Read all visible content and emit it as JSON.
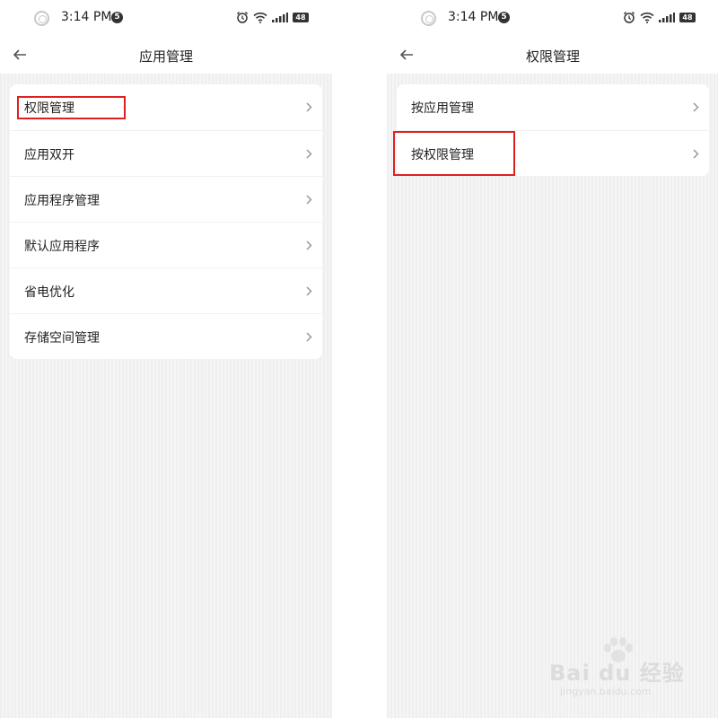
{
  "status": {
    "time": "3:14 PM",
    "badge": "5",
    "battery": "48"
  },
  "left": {
    "title": "应用管理",
    "items": [
      {
        "label": "权限管理"
      },
      {
        "label": "应用双开"
      },
      {
        "label": "应用程序管理"
      },
      {
        "label": "默认应用程序"
      },
      {
        "label": "省电优化"
      },
      {
        "label": "存储空间管理"
      }
    ]
  },
  "right": {
    "title": "权限管理",
    "items": [
      {
        "label": "按应用管理"
      },
      {
        "label": "按权限管理"
      }
    ]
  },
  "watermark": {
    "main": "Bai du 经验",
    "sub": "jingyan.baidu.com"
  },
  "colors": {
    "highlight": "#e02020",
    "card": "#ffffff",
    "background": "#f2f2f2"
  }
}
